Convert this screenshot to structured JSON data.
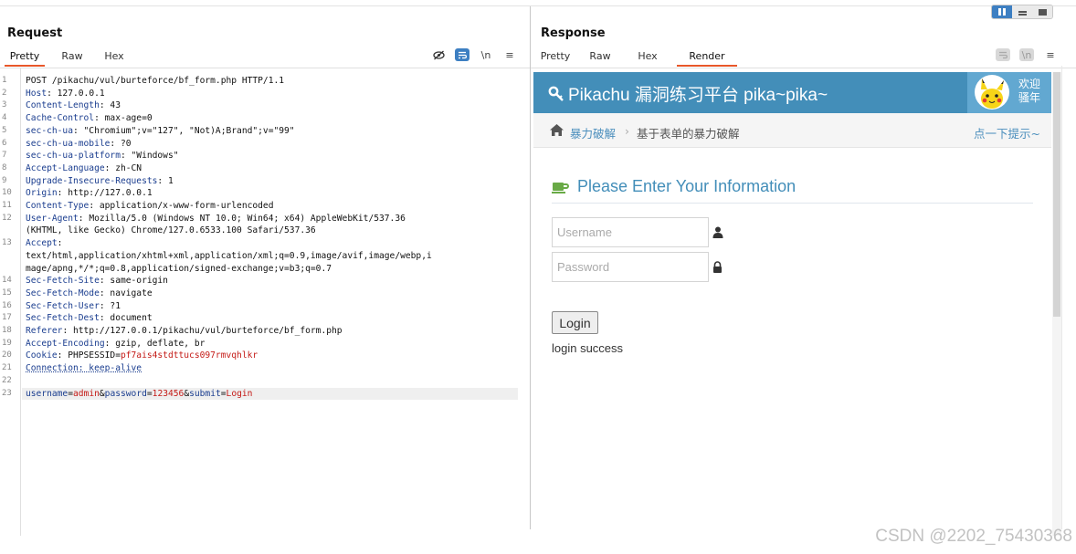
{
  "request": {
    "title": "Request",
    "tabs": [
      "Pretty",
      "Raw",
      "Hex"
    ],
    "active_tab": "Pretty",
    "tool_icons": [
      "eye-off-icon",
      "wrap-icon",
      "newline-icon",
      "menu-icon"
    ],
    "tool_newline_label": "\\n",
    "tool_menu_label": "≡",
    "lines": [
      {
        "n": "1",
        "parts": [
          {
            "t": "POST /pikachu/vul/burteforce/bf_form.php HTTP/1.1",
            "c": "v"
          }
        ]
      },
      {
        "n": "2",
        "parts": [
          {
            "t": "Host",
            "c": "k"
          },
          {
            "t": ": 127.0.0.1",
            "c": "v"
          }
        ]
      },
      {
        "n": "3",
        "parts": [
          {
            "t": "Content-Length",
            "c": "k"
          },
          {
            "t": ": 43",
            "c": "v"
          }
        ]
      },
      {
        "n": "4",
        "parts": [
          {
            "t": "Cache-Control",
            "c": "k"
          },
          {
            "t": ": max-age=0",
            "c": "v"
          }
        ]
      },
      {
        "n": "5",
        "parts": [
          {
            "t": "sec-ch-ua",
            "c": "k"
          },
          {
            "t": ": \"Chromium\";v=\"127\", \"Not)A;Brand\";v=\"99\"",
            "c": "v"
          }
        ]
      },
      {
        "n": "6",
        "parts": [
          {
            "t": "sec-ch-ua-mobile",
            "c": "k"
          },
          {
            "t": ": ?0",
            "c": "v"
          }
        ]
      },
      {
        "n": "7",
        "parts": [
          {
            "t": "sec-ch-ua-platform",
            "c": "k"
          },
          {
            "t": ": \"Windows\"",
            "c": "v"
          }
        ]
      },
      {
        "n": "8",
        "parts": [
          {
            "t": "Accept-Language",
            "c": "k"
          },
          {
            "t": ": zh-CN",
            "c": "v"
          }
        ]
      },
      {
        "n": "9",
        "parts": [
          {
            "t": "Upgrade-Insecure-Requests",
            "c": "k"
          },
          {
            "t": ": 1",
            "c": "v"
          }
        ]
      },
      {
        "n": "10",
        "parts": [
          {
            "t": "Origin",
            "c": "k"
          },
          {
            "t": ": http://127.0.0.1",
            "c": "v"
          }
        ]
      },
      {
        "n": "11",
        "parts": [
          {
            "t": "Content-Type",
            "c": "k"
          },
          {
            "t": ": application/x-www-form-urlencoded",
            "c": "v"
          }
        ]
      },
      {
        "n": "12",
        "parts": [
          {
            "t": "User-Agent",
            "c": "k"
          },
          {
            "t": ": Mozilla/5.0 (Windows NT 10.0; Win64; x64) AppleWebKit/537.36",
            "c": "v"
          }
        ]
      },
      {
        "n": "",
        "parts": [
          {
            "t": "(KHTML, like Gecko) Chrome/127.0.6533.100 Safari/537.36",
            "c": "v"
          }
        ]
      },
      {
        "n": "13",
        "parts": [
          {
            "t": "Accept",
            "c": "k"
          },
          {
            "t": ":",
            "c": "v"
          }
        ]
      },
      {
        "n": "",
        "parts": [
          {
            "t": "text/html,application/xhtml+xml,application/xml;q=0.9,image/avif,image/webp,i",
            "c": "v"
          }
        ]
      },
      {
        "n": "",
        "parts": [
          {
            "t": "mage/apng,*/*;q=0.8,application/signed-exchange;v=b3;q=0.7",
            "c": "v"
          }
        ]
      },
      {
        "n": "14",
        "parts": [
          {
            "t": "Sec-Fetch-Site",
            "c": "k"
          },
          {
            "t": ": same-origin",
            "c": "v"
          }
        ]
      },
      {
        "n": "15",
        "parts": [
          {
            "t": "Sec-Fetch-Mode",
            "c": "k"
          },
          {
            "t": ": navigate",
            "c": "v"
          }
        ]
      },
      {
        "n": "16",
        "parts": [
          {
            "t": "Sec-Fetch-User",
            "c": "k"
          },
          {
            "t": ": ?1",
            "c": "v"
          }
        ]
      },
      {
        "n": "17",
        "parts": [
          {
            "t": "Sec-Fetch-Dest",
            "c": "k"
          },
          {
            "t": ": document",
            "c": "v"
          }
        ]
      },
      {
        "n": "18",
        "parts": [
          {
            "t": "Referer",
            "c": "k"
          },
          {
            "t": ": http://127.0.0.1/pikachu/vul/burteforce/bf_form.php",
            "c": "v"
          }
        ]
      },
      {
        "n": "19",
        "parts": [
          {
            "t": "Accept-Encoding",
            "c": "k"
          },
          {
            "t": ": gzip, deflate, br",
            "c": "v"
          }
        ]
      },
      {
        "n": "20",
        "parts": [
          {
            "t": "Cookie",
            "c": "k"
          },
          {
            "t": ": PHPSESSID=",
            "c": "v"
          },
          {
            "t": "pf7ais4stdttucs097rmvqhlkr",
            "c": "r"
          }
        ]
      },
      {
        "n": "21",
        "parts": [
          {
            "t": "Connection: keep-alive",
            "c": "k squiggle"
          }
        ]
      },
      {
        "n": "22",
        "parts": []
      },
      {
        "n": "23",
        "parts": [
          {
            "t": "username",
            "c": "k"
          },
          {
            "t": "=",
            "c": "v"
          },
          {
            "t": "admin",
            "c": "r"
          },
          {
            "t": "&",
            "c": "v"
          },
          {
            "t": "password",
            "c": "k"
          },
          {
            "t": "=",
            "c": "v"
          },
          {
            "t": "123456",
            "c": "r"
          },
          {
            "t": "&",
            "c": "v"
          },
          {
            "t": "submit",
            "c": "k"
          },
          {
            "t": "=",
            "c": "v"
          },
          {
            "t": "Login",
            "c": "r"
          }
        ]
      }
    ]
  },
  "response": {
    "title": "Response",
    "tabs": [
      "Pretty",
      "Raw",
      "Hex",
      "Render"
    ],
    "active_tab": "Render",
    "tool_newline_label": "\\n",
    "tool_menu_label": "≡",
    "page": {
      "banner_title": "Pikachu 漏洞练习平台 pika~pika~",
      "welcome_line1": "欢迎",
      "welcome_line2": "骚年",
      "breadcrumb_1": "暴力破解",
      "breadcrumb_sep": "›",
      "breadcrumb_2": "基于表单的暴力破解",
      "hint": "点一下提示~",
      "form_title": "Please Enter Your Information",
      "username_placeholder": "Username",
      "password_placeholder": "Password",
      "login_button": "Login",
      "result": "login success"
    }
  },
  "watermark": "CSDN @2202_75430368",
  "colors": {
    "accent_tab": "#e8572a",
    "banner": "#438eb9",
    "header_key": "#1a3d8f",
    "value_red": "#c41a16"
  }
}
